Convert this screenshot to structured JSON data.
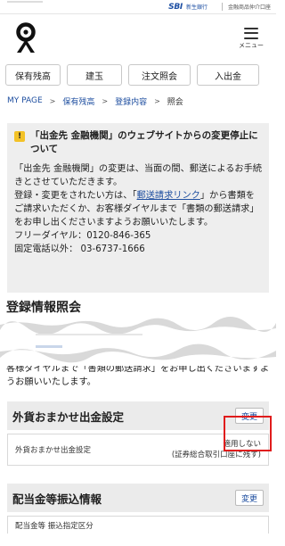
{
  "topbar": {
    "bank_logo": "SBI",
    "bank_name": "新生銀行",
    "intermediary_label": "金融商品仲介口座"
  },
  "header": {
    "logo_icon": "gold-person-logo-icon",
    "menu_label": "メニュー"
  },
  "nav": {
    "buttons": [
      "保有残高",
      "建玉",
      "注文照会",
      "入出金"
    ]
  },
  "breadcrumb": {
    "items": [
      "MY PAGE",
      "保有残高",
      "登録内容"
    ],
    "current": "照会",
    "separator": ">"
  },
  "notice": {
    "icon": "warning-icon",
    "title": "「出金先 金融機関」のウェブサイトからの変更停止について",
    "para1": "「出金先 金融機関」の変更は、当面の間、郵送によるお手続きとさせていただきます。",
    "para2_before": "登録・変更をされたい方は、「",
    "para2_link": "郵送請求リンク",
    "para2_after": "」から書類をご請求いただくか、お客様ダイヤルまで「書類の郵送請求」をお申し出くださいますようお願いいたします。",
    "freedial": "フリーダイヤル：0120-846-365",
    "landline": "固定電話以外： 03-6737-1666"
  },
  "page": {
    "section_title": "登録情報照会",
    "continued_text": "客様ダイヤルまで「書類の郵送請求」をお申し出くださいますようお願いいたします。"
  },
  "fx_panel": {
    "title": "外貨おまかせ出金設定",
    "change_label": "変更",
    "row_label": "外貨おまかせ出金設定",
    "row_value_line1": "適用しない",
    "row_value_line2": "(証券総合取引口座に残す)"
  },
  "dividend_panel": {
    "title": "配当金等振込情報",
    "change_label": "変更",
    "row_label": "配当金等 振込指定区分"
  },
  "colors": {
    "link": "#1f4fa0",
    "highlight": "#e01c1c",
    "warning": "#f3c227",
    "panel_bg": "#ebebeb"
  }
}
